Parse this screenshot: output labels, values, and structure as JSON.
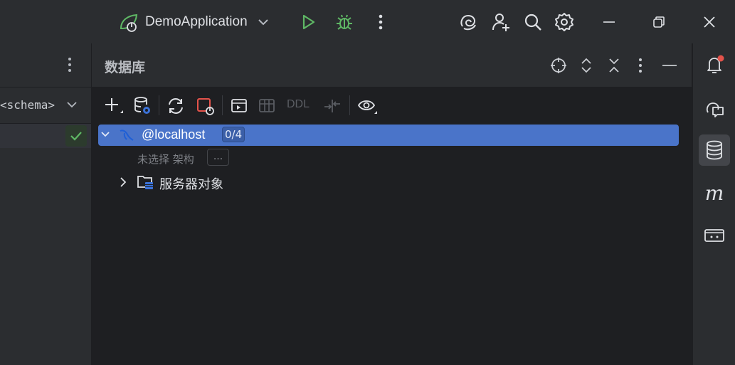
{
  "title_bar": {
    "run_config": "DemoApplication",
    "icons": [
      "spring-boot-icon",
      "chevron-down-icon",
      "run-icon",
      "debug-icon",
      "more-vertical-icon",
      "ai-assistant-icon",
      "add-user-icon",
      "search-icon",
      "settings-icon",
      "minimize-icon",
      "restore-icon",
      "close-icon"
    ]
  },
  "left_panel": {
    "schema_label": "<schema>"
  },
  "database_panel": {
    "title": "数据库",
    "toolbar": {
      "ddl_label": "DDL"
    },
    "tree": {
      "connection_label": "@localhost",
      "connection_badge": "0/4",
      "schema_hint": "未选择 架构",
      "schema_button": "...",
      "server_objects": "服务器对象"
    }
  },
  "right_stripe": {
    "items": [
      "notifications-icon",
      "ai-chat-icon",
      "database-icon",
      "maven-icon",
      "terminal-icon"
    ],
    "m_label": "m"
  },
  "colors": {
    "accent": "#4a74c9",
    "run_green": "#5fb865",
    "alert_red": "#e5534b",
    "bg": "#1e1f22",
    "panel": "#2b2d30"
  }
}
